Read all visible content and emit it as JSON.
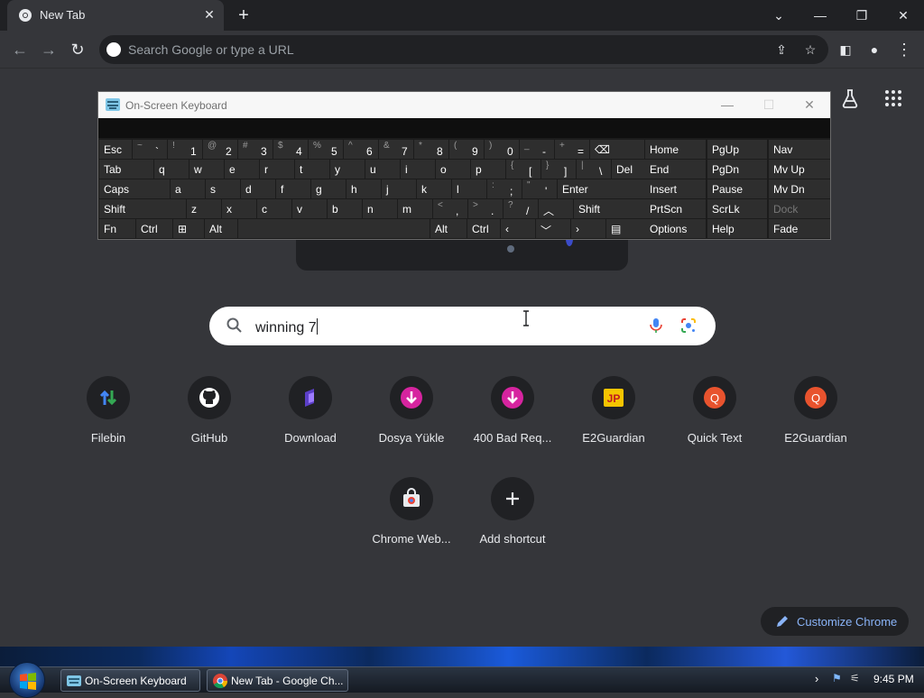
{
  "browser": {
    "tab_title": "New Tab",
    "omnibox_placeholder": "Search Google or type a URL"
  },
  "search": {
    "value": "winning 7"
  },
  "shortcuts": [
    {
      "label": "Filebin",
      "icon": "filebin-icon"
    },
    {
      "label": "GitHub",
      "icon": "github-icon"
    },
    {
      "label": "Download",
      "icon": "download-site-icon"
    },
    {
      "label": "Dosya Yükle",
      "icon": "upload-icon"
    },
    {
      "label": "400 Bad Req...",
      "icon": "upload-icon"
    },
    {
      "label": "E2Guardian",
      "icon": "jp-icon"
    },
    {
      "label": "Quick Text",
      "icon": "q-icon"
    },
    {
      "label": "E2Guardian",
      "icon": "q-icon"
    },
    {
      "label": "Chrome Web...",
      "icon": "chrome-web-store-icon"
    },
    {
      "label": "Add shortcut",
      "icon": "plus-icon"
    }
  ],
  "customize_label": "Customize Chrome",
  "osk": {
    "title": "On-Screen Keyboard",
    "rows": [
      [
        {
          "m": "Esc"
        },
        {
          "s": "~",
          "b": "`"
        },
        {
          "s": "!",
          "b": "1"
        },
        {
          "s": "@",
          "b": "2"
        },
        {
          "s": "#",
          "b": "3"
        },
        {
          "s": "$",
          "b": "4"
        },
        {
          "s": "%",
          "b": "5"
        },
        {
          "s": "^",
          "b": "6"
        },
        {
          "s": "&",
          "b": "7"
        },
        {
          "s": "*",
          "b": "8"
        },
        {
          "s": "(",
          "b": "9"
        },
        {
          "s": ")",
          "b": "0"
        },
        {
          "s": "_",
          "b": "-"
        },
        {
          "s": "+",
          "b": "="
        },
        {
          "m": "⌫"
        }
      ],
      [
        {
          "m": "Tab"
        },
        {
          "m": "q"
        },
        {
          "m": "w"
        },
        {
          "m": "e"
        },
        {
          "m": "r"
        },
        {
          "m": "t"
        },
        {
          "m": "y"
        },
        {
          "m": "u"
        },
        {
          "m": "i"
        },
        {
          "m": "o"
        },
        {
          "m": "p"
        },
        {
          "s": "{",
          "b": "["
        },
        {
          "s": "}",
          "b": "]"
        },
        {
          "s": "|",
          "b": "\\"
        },
        {
          "m": "Del"
        }
      ],
      [
        {
          "m": "Caps"
        },
        {
          "m": "a"
        },
        {
          "m": "s"
        },
        {
          "m": "d"
        },
        {
          "m": "f"
        },
        {
          "m": "g"
        },
        {
          "m": "h"
        },
        {
          "m": "j"
        },
        {
          "m": "k"
        },
        {
          "m": "l"
        },
        {
          "s": ":",
          "b": ";"
        },
        {
          "s": "\"",
          "b": "'"
        },
        {
          "m": "Enter"
        }
      ],
      [
        {
          "m": "Shift"
        },
        {
          "m": "z"
        },
        {
          "m": "x"
        },
        {
          "m": "c"
        },
        {
          "m": "v"
        },
        {
          "m": "b"
        },
        {
          "m": "n"
        },
        {
          "m": "m"
        },
        {
          "s": "<",
          "b": ","
        },
        {
          "s": ">",
          "b": "."
        },
        {
          "s": "?",
          "b": "/"
        },
        {
          "m": "︿"
        },
        {
          "m": "Shift"
        }
      ],
      [
        {
          "m": "Fn"
        },
        {
          "m": "Ctrl"
        },
        {
          "m": "⊞"
        },
        {
          "m": "Alt"
        },
        {
          "m": ""
        },
        {
          "m": "Alt"
        },
        {
          "m": "Ctrl"
        },
        {
          "m": "‹"
        },
        {
          "m": "﹀"
        },
        {
          "m": "›"
        },
        {
          "m": "▤"
        }
      ]
    ],
    "nav_rows": [
      [
        "Home",
        "PgUp",
        "Nav"
      ],
      [
        "End",
        "PgDn",
        "Mv Up"
      ],
      [
        "Insert",
        "Pause",
        "Mv Dn"
      ],
      [
        "PrtScn",
        "ScrLk",
        "Dock"
      ],
      [
        "Options",
        "Help",
        "Fade"
      ]
    ]
  },
  "taskbar": {
    "items": [
      {
        "label": "On-Screen Keyboard"
      },
      {
        "label": "New Tab - Google Ch..."
      }
    ],
    "clock": "9:45 PM"
  }
}
